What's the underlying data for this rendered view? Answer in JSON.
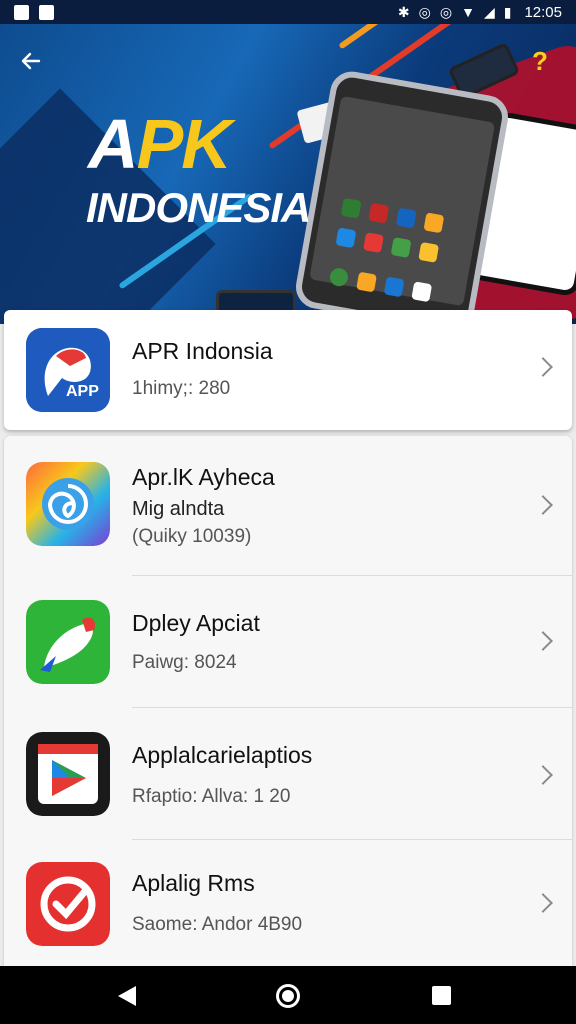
{
  "status_bar": {
    "time": "12:05",
    "icons": [
      "image-icon",
      "message-icon",
      "bluetooth-icon",
      "alarm-icon",
      "wifi-icon",
      "signal-icon",
      "battery-icon"
    ]
  },
  "hero": {
    "title_part1": "A",
    "title_part2": "PK",
    "subtitle": "INDONESIA",
    "back_icon": "arrow-left-icon",
    "help_symbol": "?"
  },
  "featured": {
    "title": "APR Indonsia",
    "subtitle": "1himy;: 280",
    "icon_label": "APP"
  },
  "apps": [
    {
      "title": "Apr.lK Ayheca",
      "line2": "Mig alndta",
      "line3": "(Quiky 10039)"
    },
    {
      "title": "Dpley Apciat",
      "line2": "Paiwg: 8024"
    },
    {
      "title": "Applalcarielaptios",
      "line2": "Rfaptio: Allva: 1 20"
    },
    {
      "title": "Aplalig Rms",
      "line2": "Saome: Andor 4B90"
    }
  ],
  "colors": {
    "status_bg": "#0b1d3f",
    "accent_yellow": "#f7c81b",
    "nav_bg": "#000000"
  }
}
